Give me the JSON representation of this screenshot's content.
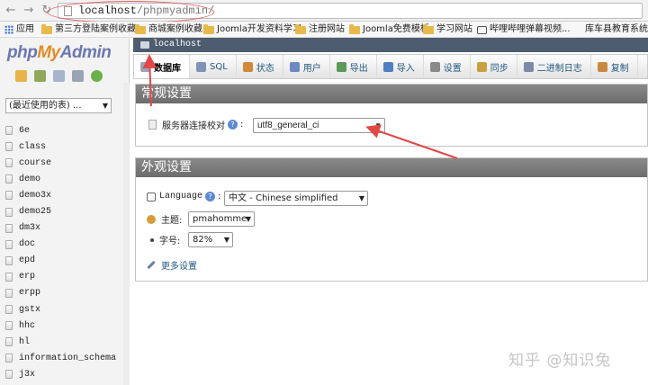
{
  "browser": {
    "url_host": "localhost",
    "url_path": "/phpmyadmin/"
  },
  "bookmarks": [
    {
      "label": "应用",
      "icon": "apps-grid-icon"
    },
    {
      "label": "第三方登陆案例收藏",
      "icon": "folder-icon"
    },
    {
      "label": "商城案例收藏",
      "icon": "folder-icon"
    },
    {
      "label": "Joomla开发资料学习",
      "icon": "folder-icon"
    },
    {
      "label": "注册网站",
      "icon": "folder-icon"
    },
    {
      "label": "Joomla免费模板",
      "icon": "folder-icon"
    },
    {
      "label": "学习网站",
      "icon": "folder-icon"
    },
    {
      "label": "哔哩哔哩弹幕视频...",
      "icon": "bilibili-icon"
    },
    {
      "label": "库车县教育系统学",
      "icon": "none"
    }
  ],
  "sidebar": {
    "logo_php": "php",
    "logo_my": "My",
    "logo_admin": "Admin",
    "recent_select": "(最近使用的表) ...",
    "databases": [
      "6e",
      "class",
      "course",
      "demo",
      "demo3x",
      "demo25",
      "dm3x",
      "doc",
      "epd",
      "erp",
      "erpp",
      "gstx",
      "hhc",
      "hl",
      "information_schema",
      "j3x"
    ]
  },
  "breadcrumb": {
    "server": "localhost"
  },
  "tabs": [
    {
      "label": "数据库",
      "icon": "database-icon"
    },
    {
      "label": "SQL",
      "icon": "sql-icon"
    },
    {
      "label": "状态",
      "icon": "status-icon"
    },
    {
      "label": "用户",
      "icon": "users-icon"
    },
    {
      "label": "导出",
      "icon": "export-icon"
    },
    {
      "label": "导入",
      "icon": "import-icon"
    },
    {
      "label": "设置",
      "icon": "wrench-icon"
    },
    {
      "label": "同步",
      "icon": "sync-icon"
    },
    {
      "label": "二进制日志",
      "icon": "binlog-icon"
    },
    {
      "label": "复制",
      "icon": "replication-icon"
    }
  ],
  "general_settings": {
    "title": "常规设置",
    "collation_label": "服务器连接校对",
    "collation_value": "utf8_general_ci"
  },
  "appearance_settings": {
    "title": "外观设置",
    "language_label": "Language",
    "language_value": "中文 - Chinese simplified",
    "theme_label": "主题:",
    "theme_value": "pmahomme",
    "fontsize_label": "字号:",
    "fontsize_value": "82%",
    "more_settings": "更多设置"
  },
  "watermark": "知乎 @知识兔",
  "colors": {
    "annotation_red": "#e04848",
    "link_blue": "#235a81",
    "panel_header": "#7b7b7b",
    "breadcrumb_bg": "#4d5c6e"
  }
}
